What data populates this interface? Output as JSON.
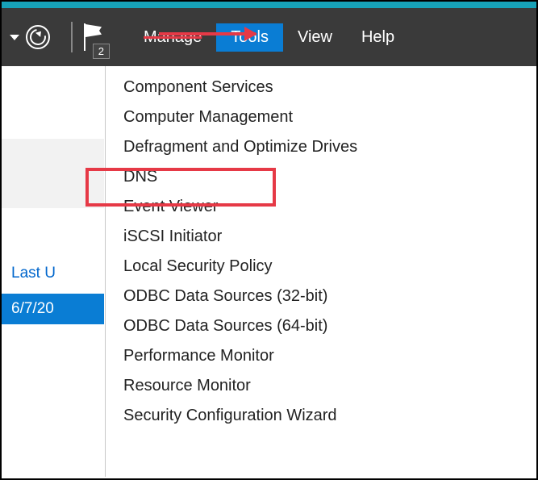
{
  "toolbar": {
    "flag_badge": "2",
    "menu": {
      "manage": "Manage",
      "tools": "Tools",
      "view": "View",
      "help": "Help"
    }
  },
  "left": {
    "last_updated": "Last U",
    "date": "6/7/20"
  },
  "dropdown": {
    "items": [
      "Component Services",
      "Computer Management",
      "Defragment and Optimize Drives",
      "DNS",
      "Event Viewer",
      "iSCSI Initiator",
      "Local Security Policy",
      "ODBC Data Sources (32-bit)",
      "ODBC Data Sources (64-bit)",
      "Performance Monitor",
      "Resource Monitor",
      "Security Configuration Wizard"
    ],
    "highlight_index": 3
  }
}
